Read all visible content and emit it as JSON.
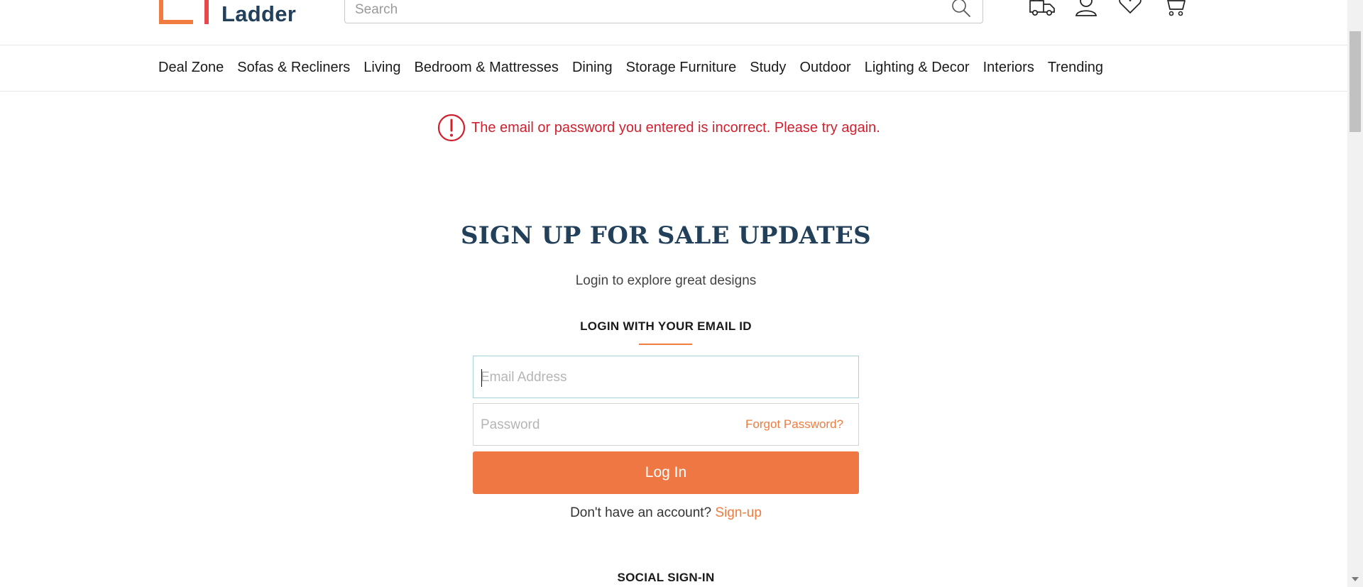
{
  "header": {
    "logo_text": "Ladder",
    "search": {
      "placeholder": "Search",
      "value": ""
    },
    "icons": [
      "delivery-truck-icon",
      "user-icon",
      "heart-icon",
      "cart-icon"
    ]
  },
  "nav": {
    "items": [
      {
        "label": "Deal Zone"
      },
      {
        "label": "Sofas & Recliners"
      },
      {
        "label": "Living"
      },
      {
        "label": "Bedroom & Mattresses"
      },
      {
        "label": "Dining"
      },
      {
        "label": "Storage Furniture"
      },
      {
        "label": "Study"
      },
      {
        "label": "Outdoor"
      },
      {
        "label": "Lighting & Decor"
      },
      {
        "label": "Interiors"
      },
      {
        "label": "Trending"
      }
    ]
  },
  "error": {
    "message": "The email or password you entered is incorrect. Please try again.",
    "color": "#d11f2e"
  },
  "main": {
    "title": "SIGN UP FOR SALE UPDATES",
    "subtitle": "Login to explore great designs",
    "section_label": "LOGIN WITH YOUR EMAIL ID",
    "email": {
      "placeholder": "Email Address",
      "value": ""
    },
    "password": {
      "placeholder": "Password",
      "value": ""
    },
    "forgot_label": "Forgot Password?",
    "login_label": "Log In",
    "signup_prompt": "Don't have an account?",
    "signup_link": "Sign-up",
    "social_label": "SOCIAL SIGN-IN"
  },
  "colors": {
    "accent": "#ee7744",
    "brand_navy": "#23405a"
  }
}
